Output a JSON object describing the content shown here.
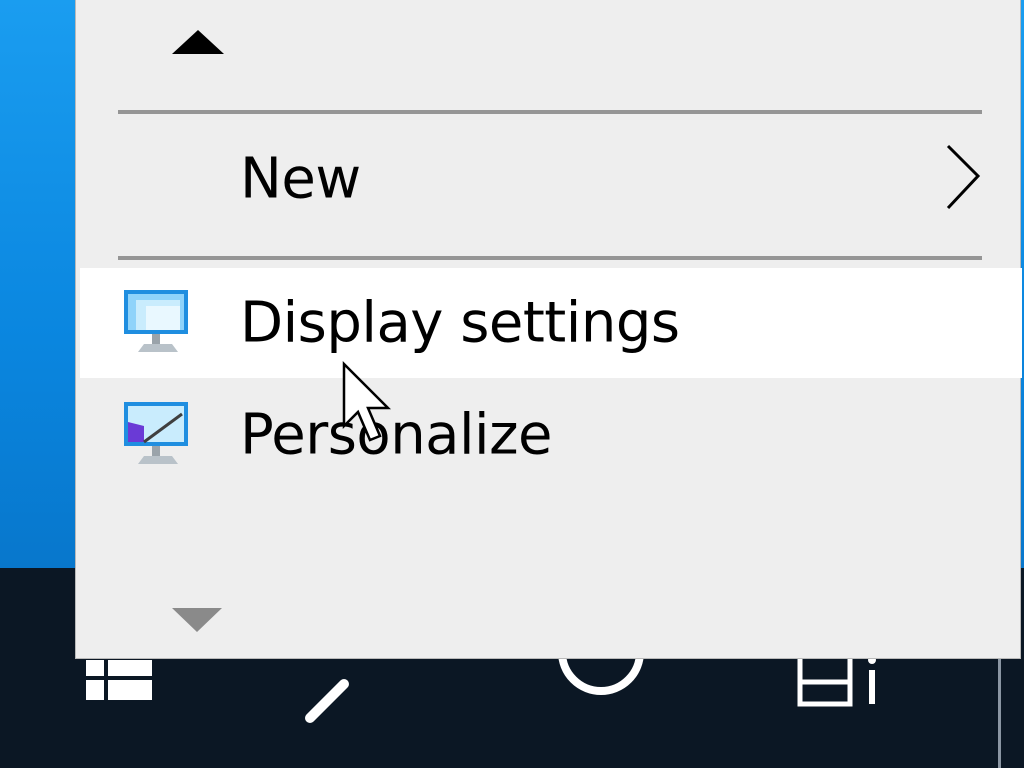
{
  "desktop": {
    "background_color": "#0a86df"
  },
  "taskbar": {
    "background_color": "#0b1724",
    "icons": [
      "windows-logo-icon",
      "search-icon",
      "cortana-icon",
      "task-view-icon"
    ]
  },
  "context_menu": {
    "items": [
      {
        "label": "New",
        "has_submenu": true,
        "icon": null
      },
      {
        "label": "Display settings",
        "has_submenu": false,
        "icon": "display-settings-icon",
        "hovered": true
      },
      {
        "label": "Personalize",
        "has_submenu": false,
        "icon": "personalize-icon"
      }
    ],
    "scroll_up_icon": "triangle-up-icon",
    "scroll_down_icon": "triangle-down-icon",
    "hover_color": "#ffffff",
    "background_color": "#eeeeee"
  },
  "pointer": "mouse-cursor-icon"
}
